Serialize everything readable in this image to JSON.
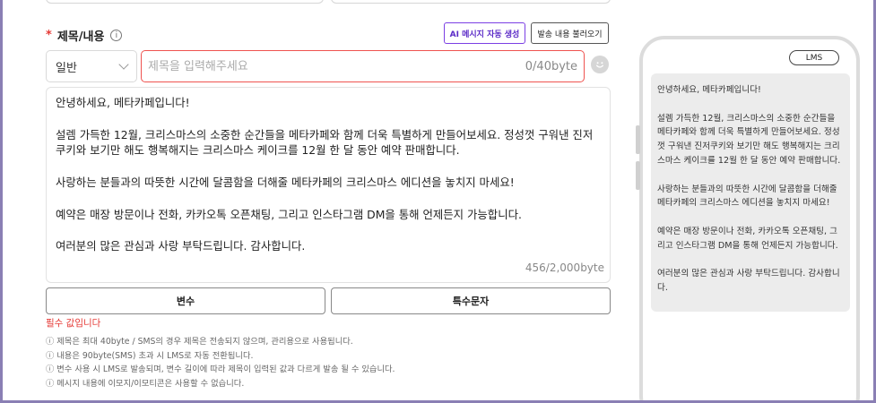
{
  "field": {
    "required_mark": "*",
    "label": "제목/내용",
    "info": "i"
  },
  "actions": {
    "ai_generate": "AI 메시지 자동 생성",
    "load_content": "발송 내용 불러오기"
  },
  "type_select": {
    "value": "일반"
  },
  "title_input": {
    "placeholder": "제목을 입력해주세요",
    "value": "",
    "counter": "0/40byte"
  },
  "message": {
    "body": "안녕하세요, 메타카페입니다!\n\n설렘 가득한 12월, 크리스마스의 소중한 순간들을 메타카페와 함께 더욱 특별하게 만들어보세요. 정성껏 구워낸 진저쿠키와 보기만 해도 행복해지는 크리스마스 케이크를 12월 한 달 동안 예약 판매합니다.\n\n사랑하는 분들과의 따뜻한 시간에 달콤함을 더해줄 메타카페의 크리스마스 에디션을 놓치지 마세요!\n\n예약은 매장 방문이나 전화, 카카오톡 오픈채팅, 그리고 인스타그램 DM을 통해 언제든지 가능합니다.\n\n여러분의 많은 관심과 사랑 부탁드립니다. 감사합니다.",
    "counter": "456/2,000byte"
  },
  "buttons": {
    "variable": "변수",
    "special_chars": "특수문자"
  },
  "error": "필수 값입니다",
  "notes": [
    "ⓘ 제목은 최대 40byte / SMS의 경우 제목은 전송되지 않으며, 관리용으로 사용됩니다.",
    "ⓘ 내용은 90byte(SMS) 초과 시 LMS로 자동 전환됩니다.",
    "ⓘ 변수 사용 시 LMS로 발송되며, 변수 길이에 따라 제목이 입력된 값과 다르게 발송 될 수 있습니다.",
    "ⓘ 메시지 내용에 이모지/이모티콘은 사용할 수 없습니다."
  ],
  "preview": {
    "badge": "LMS",
    "body": "안녕하세요, 메타카페입니다!\n\n설렘 가득한 12월, 크리스마스의 소중한 순간들을 메타카페와 함께 더욱 특별하게 만들어보세요. 정성껏 구워낸 진저쿠키와 보기만 해도 행복해지는 크리스마스 케이크를 12월 한 달 동안 예약 판매합니다.\n\n사랑하는 분들과의 따뜻한 시간에 달콤함을 더해줄 메타카페의 크리스마스 에디션을 놓치지 마세요!\n\n예약은 매장 방문이나 전화, 카카오톡 오픈채팅, 그리고 인스타그램 DM을 통해 언제든지 가능합니다.\n\n여러분의 많은 관심과 사랑 부탁드립니다. 감사합니다."
  },
  "colors": {
    "accent": "#7b3fe4",
    "error": "#e53935",
    "frame": "#8a7fb4"
  }
}
